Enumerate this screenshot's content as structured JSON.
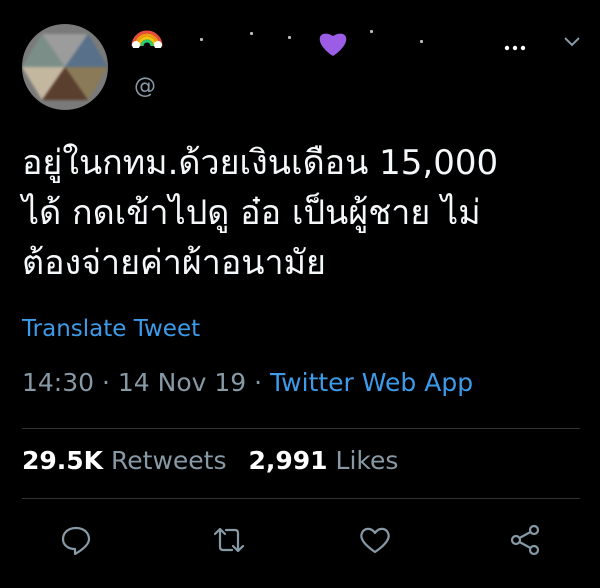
{
  "header": {
    "display_name_emoji_left": "rainbow",
    "display_name_emoji_right": "purple-heart",
    "handle": "@",
    "more_label": "...",
    "colors": {
      "heart": "#9b5de5",
      "link": "#3d9be9",
      "muted": "#8899a6"
    }
  },
  "tweet": {
    "text": "อยู่ในกทม.ด้วยเงินเดือน 15,000\nได้ กดเข้าไปดู อ๋อ เป็นผู้ชาย ไม่\nต้องจ่ายค่าผ้าอนามัย",
    "translate_label": "Translate Tweet",
    "time": "14:30",
    "sep1": " · ",
    "date": "14 Nov 19",
    "sep2": " · ",
    "source": "Twitter Web App"
  },
  "stats": {
    "retweets_count": "29.5K",
    "retweets_label": " Retweets",
    "likes_count": "2,991",
    "likes_label": " Likes"
  },
  "actions": {
    "icons": [
      "reply-icon",
      "retweet-icon",
      "like-icon",
      "share-icon"
    ]
  }
}
